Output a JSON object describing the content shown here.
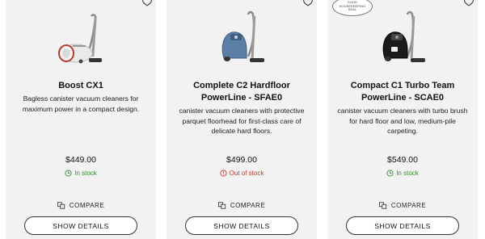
{
  "products": [
    {
      "name": "Boost CX1",
      "description": "Bagless canister vacuum cleaners for maximum power in a compact design.",
      "price": "$449.00",
      "stock": "In stock",
      "compare_label": "COMPARE",
      "details_label": "SHOW DETAILS",
      "image_icon": "vacuum-bagless-white-red",
      "status_color": "#3a8a3a"
    },
    {
      "name": "Complete C2 Hardfloor PowerLine - SFAE0",
      "description": "canister vacuum cleaners with protective parquet floorhead for first-class care of delicate hard floors.",
      "price": "$499.00",
      "stock": "Out of stock",
      "compare_label": "COMPARE",
      "details_label": "SHOW DETAILS",
      "image_icon": "vacuum-canister-blue",
      "status_color": "#c0392b"
    },
    {
      "name": "Compact C1 Turbo Team PowerLine - SCAE0",
      "description": "canister vacuum cleaners with turbo brush for hard floor and low, medium-pile carpeting.",
      "price": "$549.00",
      "stock": "In stock",
      "compare_label": "COMPARE",
      "details_label": "SHOW DETAILS",
      "image_icon": "vacuum-canister-black",
      "badge": [
        "GOOD",
        "HOUSEKEEPING",
        "SEAL"
      ],
      "status_color": "#3a8a3a"
    }
  ]
}
